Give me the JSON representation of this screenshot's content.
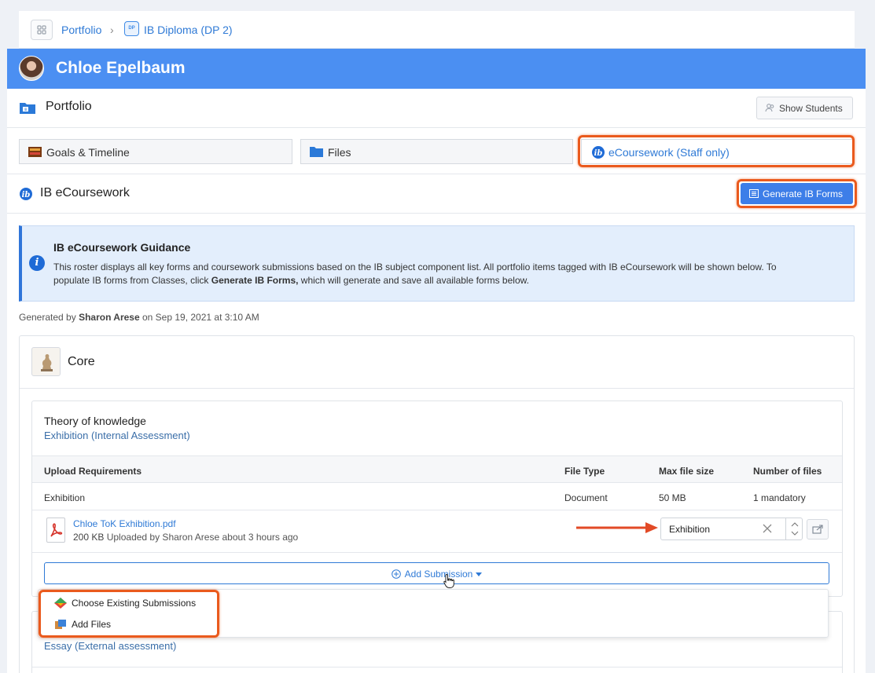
{
  "breadcrumb": {
    "root": "Portfolio",
    "separator": "›",
    "current": "IB Diploma (DP 2)",
    "badge": "DP"
  },
  "header": {
    "student_name": "Chloe Epelbaum"
  },
  "portfolio": {
    "title": "Portfolio",
    "show_students_label": "Show Students"
  },
  "tabs": [
    {
      "label": "Goals & Timeline"
    },
    {
      "label": "Files"
    },
    {
      "label": "eCoursework (Staff only)"
    }
  ],
  "section": {
    "title": "IB eCoursework",
    "generate_label": "Generate IB Forms"
  },
  "guidance": {
    "title": "IB eCoursework Guidance",
    "body_line1": "This roster displays all key forms and coursework submissions based on the IB subject component list. All portfolio items tagged with IB eCoursework will be shown below. To",
    "body_prefix": "populate IB forms from Classes, click",
    "body_bold": "Generate IB Forms,",
    "body_suffix": "which will generate and save all available forms below."
  },
  "generated": {
    "prefix": "Generated by",
    "author": "Sharon Arese",
    "suffix": "on Sep 19, 2021 at 3:10 AM"
  },
  "core": {
    "title": "Core"
  },
  "tok": {
    "subject": "Theory of knowledge",
    "component": "Exhibition (Internal Assessment)",
    "headers": [
      "Upload Requirements",
      "File Type",
      "Max file size",
      "Number of files"
    ],
    "row": [
      "Exhibition",
      "Document",
      "50 MB",
      "1 mandatory"
    ],
    "file": {
      "name": "Chloe ToK Exhibition.pdf",
      "size": "200 KB",
      "meta": "Uploaded by Sharon Arese about 3 hours ago",
      "tag": "Exhibition"
    },
    "add_submission_label": "Add Submission"
  },
  "dropdown": {
    "items": [
      "Choose Existing Submissions",
      "Add Files"
    ]
  },
  "next_component": "Essay (External assessment)",
  "colors": {
    "accent": "#4b8ff2",
    "highlight": "#ea5a1d",
    "link": "#2f7ad6"
  }
}
